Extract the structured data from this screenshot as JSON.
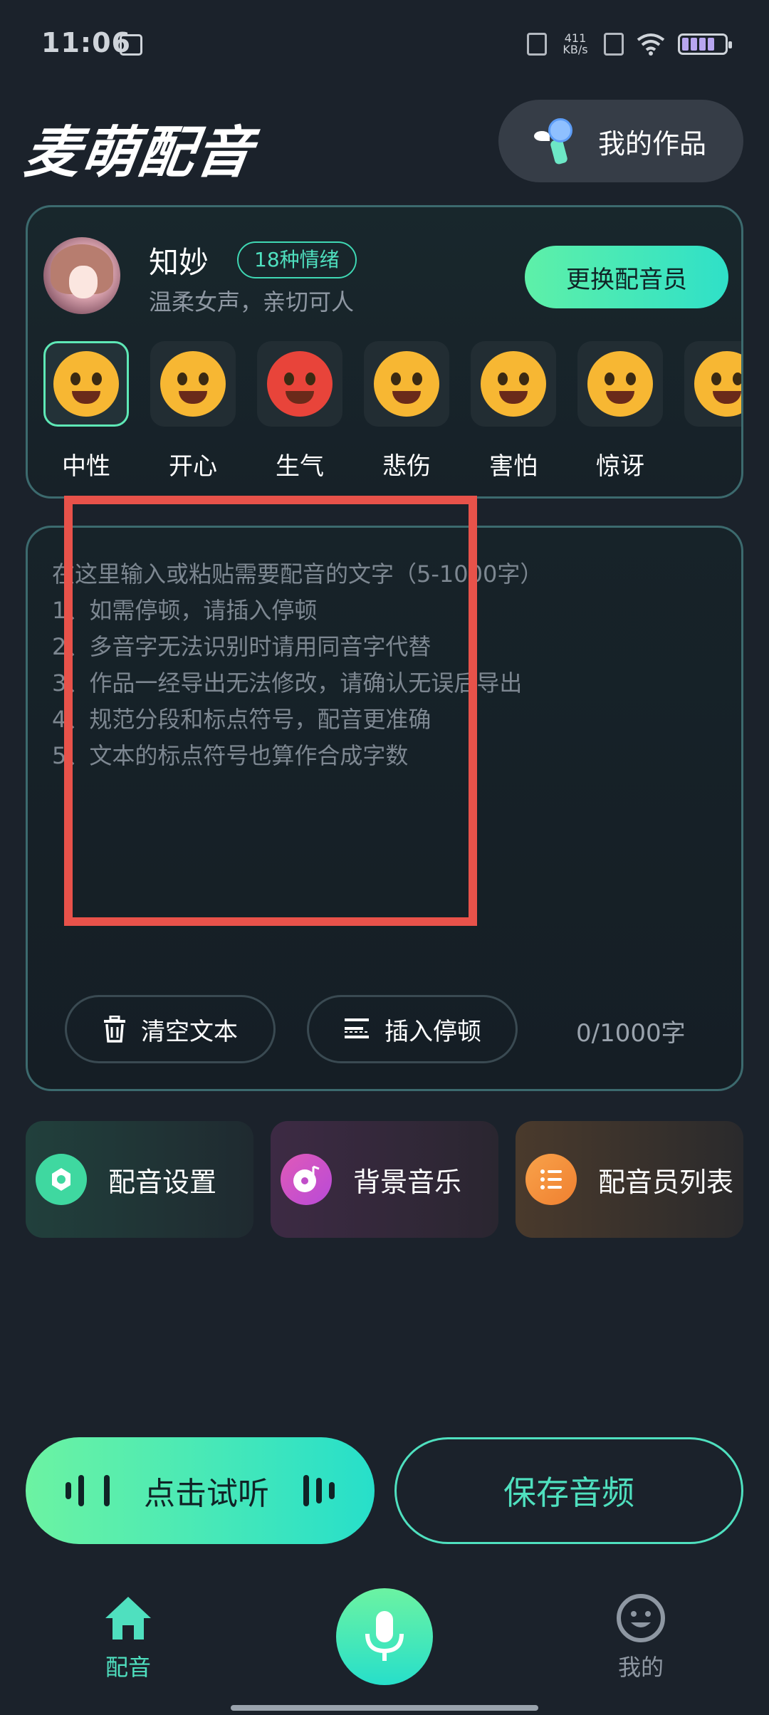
{
  "status_bar": {
    "time": "11:06",
    "net_speed_value": "411",
    "net_speed_unit": "KB/s"
  },
  "header": {
    "app_title": "麦萌配音",
    "my_works_label": "我的作品"
  },
  "voice_card": {
    "name": "知妙",
    "emotion_badge": "18种情绪",
    "description": "温柔女声，亲切可人",
    "change_voice_label": "更换配音员",
    "emotions": [
      {
        "label": "中性",
        "icon": "neutral-face-icon",
        "color": "#f7b733",
        "selected": true
      },
      {
        "label": "开心",
        "icon": "laughing-face-icon",
        "color": "#f7b733"
      },
      {
        "label": "生气",
        "icon": "angry-face-icon",
        "color": "#e8443a"
      },
      {
        "label": "悲伤",
        "icon": "crying-face-icon",
        "color": "#f7b733"
      },
      {
        "label": "害怕",
        "icon": "pleading-face-icon",
        "color": "#f7b733"
      },
      {
        "label": "惊讶",
        "icon": "screaming-face-icon",
        "color": "#f7b733"
      },
      {
        "label": "",
        "icon": "partial-face-icon",
        "color": "#f7b733"
      }
    ]
  },
  "editor": {
    "placeholder": "在这里输入或粘贴需要配音的文字（5-1000字）\n1、如需停顿，请插入停顿\n2、多音字无法识别时请用同音字代替\n3、作品一经导出无法修改，请确认无误后导出\n4、规范分段和标点符号，配音更准确\n5、文本的标点符号也算作合成字数",
    "clear_label": "清空文本",
    "insert_pause_label": "插入停顿",
    "char_count": "0/1000字"
  },
  "tiles": {
    "voice_settings": "配音设置",
    "bg_music": "背景音乐",
    "voice_list": "配音员列表"
  },
  "actions": {
    "listen_label": "点击试听",
    "save_label": "保存音频"
  },
  "bottom_nav": {
    "home_label": "配音",
    "mine_label": "我的"
  },
  "colors": {
    "accent": "#4fe0bf",
    "background": "#1b222b",
    "highlight": "#e8524a"
  }
}
